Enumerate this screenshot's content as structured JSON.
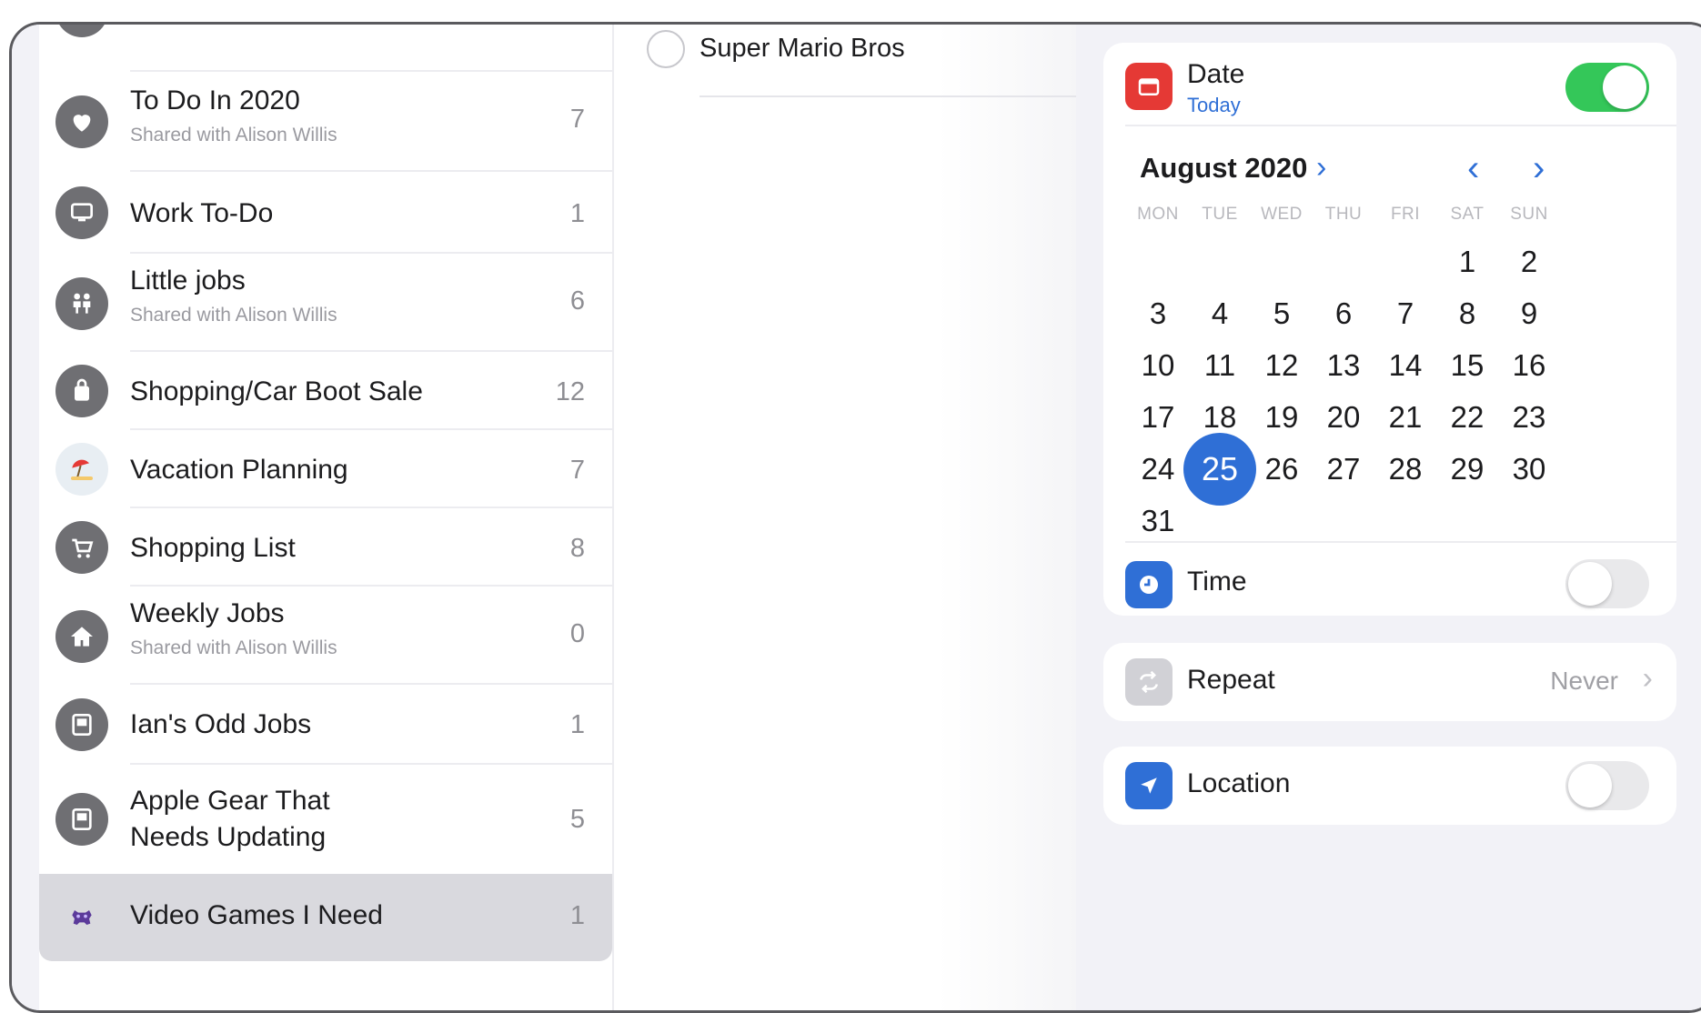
{
  "lists": [
    {
      "name": "To Do In 2020",
      "subtitle": "Shared with Alison Willis",
      "count": "7",
      "icon": "heart-icon"
    },
    {
      "name": "Work To-Do",
      "subtitle": "",
      "count": "1",
      "icon": "monitor-icon"
    },
    {
      "name": "Little jobs",
      "subtitle": "Shared with Alison Willis",
      "count": "6",
      "icon": "people-icon"
    },
    {
      "name": "Shopping/Car Boot Sale",
      "subtitle": "",
      "count": "12",
      "icon": "bag-icon"
    },
    {
      "name": "Vacation Planning",
      "subtitle": "",
      "count": "7",
      "icon": "beach-umbrella-icon"
    },
    {
      "name": "Shopping List",
      "subtitle": "",
      "count": "8",
      "icon": "cart-icon"
    },
    {
      "name": "Weekly Jobs",
      "subtitle": "Shared with Alison Willis",
      "count": "0",
      "icon": "house-icon"
    },
    {
      "name": "Ian's Odd Jobs",
      "subtitle": "",
      "count": "1",
      "icon": "computer-icon"
    },
    {
      "name": "Apple Gear That Needs Updating",
      "subtitle": "",
      "count": "5",
      "icon": "computer-icon"
    },
    {
      "name": "Video Games I Need",
      "subtitle": "",
      "count": "1",
      "icon": "game-icon"
    }
  ],
  "reminder": {
    "title": "Super Mario Bros"
  },
  "detail": {
    "date": {
      "label": "Date",
      "value": "Today",
      "enabled": true,
      "icon": "calendar-icon"
    },
    "calendar": {
      "month_label": "August 2020",
      "weekdays": [
        "MON",
        "TUE",
        "WED",
        "THU",
        "FRI",
        "SAT",
        "SUN"
      ],
      "first_weekday_index": 5,
      "days_in_month": 31,
      "selected_day": 25,
      "prev_icon": "chevron-left-icon",
      "next_icon": "chevron-right-icon"
    },
    "time": {
      "label": "Time",
      "enabled": false,
      "icon": "clock-icon"
    },
    "repeat": {
      "label": "Repeat",
      "value": "Never",
      "icon": "repeat-icon"
    },
    "location": {
      "label": "Location",
      "enabled": false,
      "icon": "location-arrow-icon"
    }
  },
  "colors": {
    "accent": "#2f6fd6",
    "toggle_on": "#34c759",
    "date_icon": "#e53935",
    "list_icon": "#6f6f73"
  }
}
